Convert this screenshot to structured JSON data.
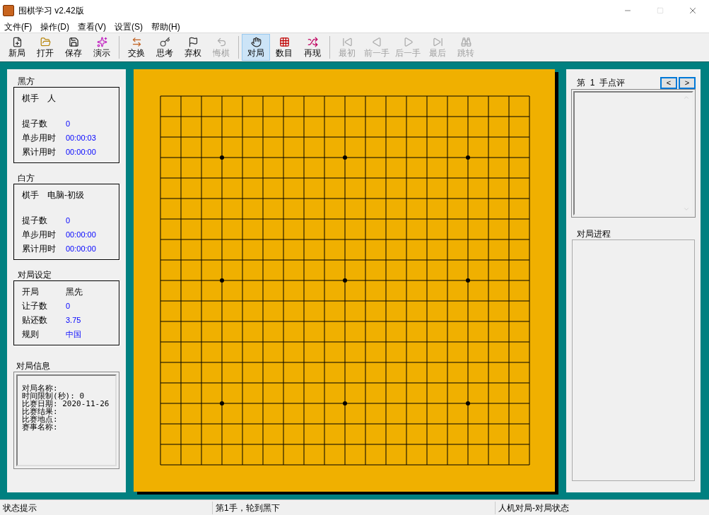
{
  "window": {
    "title": "围棋学习 v2.42版"
  },
  "menu": [
    "文件(F)",
    "操作(D)",
    "查看(V)",
    "设置(S)",
    "帮助(H)"
  ],
  "toolbar": {
    "groups": [
      [
        {
          "label": "新局",
          "disabled": false,
          "selected": false
        },
        {
          "label": "打开",
          "disabled": false,
          "selected": false
        },
        {
          "label": "保存",
          "disabled": false,
          "selected": false
        },
        {
          "label": "演示",
          "disabled": false,
          "selected": false
        }
      ],
      [
        {
          "label": "交换",
          "disabled": false,
          "selected": false
        },
        {
          "label": "思考",
          "disabled": false,
          "selected": false
        },
        {
          "label": "弃权",
          "disabled": false,
          "selected": false
        },
        {
          "label": "悔棋",
          "disabled": true,
          "selected": false
        }
      ],
      [
        {
          "label": "对局",
          "disabled": false,
          "selected": true
        },
        {
          "label": "数目",
          "disabled": false,
          "selected": false
        },
        {
          "label": "再现",
          "disabled": false,
          "selected": false
        }
      ],
      [
        {
          "label": "最初",
          "disabled": true,
          "selected": false
        },
        {
          "label": "前一手",
          "disabled": true,
          "selected": false
        },
        {
          "label": "后一手",
          "disabled": true,
          "selected": false
        },
        {
          "label": "最后",
          "disabled": true,
          "selected": false
        },
        {
          "label": "跳转",
          "disabled": true,
          "selected": false
        }
      ]
    ]
  },
  "groups": [
    {
      "title": "黑方",
      "rows": [
        {
          "label": "棋手",
          "value": "人",
          "kind": "player"
        },
        {
          "label": "提子数",
          "value": "0",
          "kind": "stat"
        },
        {
          "label": "单步用时",
          "value": "00:00:03",
          "kind": "stat"
        },
        {
          "label": "累计用时",
          "value": "00:00:00",
          "kind": "stat"
        }
      ]
    },
    {
      "title": "白方",
      "rows": [
        {
          "label": "棋手",
          "value": "电脑-初级",
          "kind": "player"
        },
        {
          "label": "提子数",
          "value": "0",
          "kind": "stat"
        },
        {
          "label": "单步用时",
          "value": "00:00:00",
          "kind": "stat"
        },
        {
          "label": "累计用时",
          "value": "00:00:00",
          "kind": "stat"
        }
      ]
    },
    {
      "title": "对局设定",
      "rows": [
        {
          "label": "开局",
          "value": "黑先",
          "kind": "plain"
        },
        {
          "label": "让子数",
          "value": "0",
          "kind": "stat"
        },
        {
          "label": "贴还数",
          "value": "3.75",
          "kind": "stat"
        },
        {
          "label": "规则",
          "value": "中国",
          "kind": "stat"
        }
      ]
    }
  ],
  "game_info": {
    "title": "对局信息",
    "lines": [
      "对局名称:",
      "时间限制(秒): 0",
      "比赛日期: 2020-11-26",
      "比赛结果:",
      "比赛地点:",
      "赛事名称:"
    ]
  },
  "comment": {
    "word_before": "第",
    "move_number": "1",
    "word_after": "手点评",
    "prev": "<",
    "next": ">"
  },
  "progress": {
    "title": "对局进程"
  },
  "status_bar": [
    "状态提示",
    "第1手，轮到黑下",
    "人机对局-对局状态"
  ]
}
